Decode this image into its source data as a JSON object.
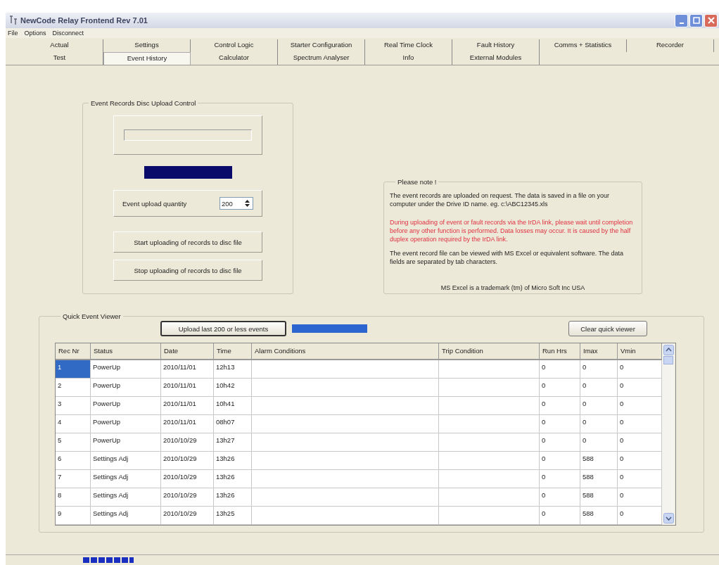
{
  "window": {
    "title": "NewCode Relay Frontend  Rev 7.01"
  },
  "menu": [
    "File",
    "Options",
    "Disconnect"
  ],
  "tabs": [
    [
      {
        "label": "Actual",
        "selected": false
      },
      {
        "label": "Settings",
        "selected": false
      },
      {
        "label": "Control Logic",
        "selected": false
      },
      {
        "label": "Starter Configuration",
        "selected": false
      },
      {
        "label": "Real Time Clock",
        "selected": false
      },
      {
        "label": "Fault History",
        "selected": false
      },
      {
        "label": "Comms + Statistics",
        "selected": false
      },
      {
        "label": "Recorder",
        "selected": false
      }
    ],
    [
      {
        "label": "Test",
        "selected": false
      },
      {
        "label": "Event History",
        "selected": true
      },
      {
        "label": "Calculator",
        "selected": false
      },
      {
        "label": "Spectrum Analyser",
        "selected": false
      },
      {
        "label": "Info",
        "selected": false
      },
      {
        "label": "External Modules",
        "selected": false
      }
    ]
  ],
  "upload_control": {
    "title": "Event Records Disc Upload Control",
    "progress": {
      "level": 1
    },
    "quantity_label": "Event upload quantity",
    "quantity": "200",
    "buttons": [
      "Start uploading of records to disc file",
      "Stop uploading of records to disc file"
    ]
  },
  "note": {
    "title": "Please note !",
    "paragraphs": [
      {
        "kind": "normal",
        "text": "The event records are uploaded on request.  The data is saved in a file on your computer under the Drive ID name.   eg.  c:\\ABC12345.xls"
      },
      {
        "kind": "warning",
        "text": "During uploading of event or fault records via the IrDA link, please wait until completion before any other function is performed.  Data losses may occur. It is caused by the half duplex operation required by the IrDA link."
      },
      {
        "kind": "normal",
        "text": "The event record file can be viewed with MS Excel or equivalent software. The data fields are separated by tab characters."
      }
    ],
    "footer": "MS Excel is a trademark (tm) of Micro Soft Inc USA"
  },
  "viewer": {
    "title": "Quick Event Viewer",
    "upload_button": "Upload last 200 or less events",
    "clear_button": "Clear quick viewer",
    "columns": [
      "Rec Nr",
      "Status",
      "Date",
      "Time",
      "Alarm Conditions",
      "Trip Condition",
      "Run Hrs",
      "Imax",
      "Vmin"
    ],
    "rows": [
      {
        "rec": "1",
        "status": "PowerUp",
        "date": "2010/11/01",
        "time": "12h13",
        "run_hrs": "0",
        "imax": "0",
        "vmin": "0",
        "selected": true
      },
      {
        "rec": "2",
        "status": "PowerUp",
        "date": "2010/11/01",
        "time": "10h42",
        "run_hrs": "0",
        "imax": "0",
        "vmin": "0",
        "selected": false
      },
      {
        "rec": "3",
        "status": "PowerUp",
        "date": "2010/11/01",
        "time": "10h41",
        "run_hrs": "0",
        "imax": "0",
        "vmin": "0",
        "selected": false
      },
      {
        "rec": "4",
        "status": "PowerUp",
        "date": "2010/11/01",
        "time": "08h07",
        "run_hrs": "0",
        "imax": "0",
        "vmin": "0",
        "selected": false
      },
      {
        "rec": "5",
        "status": "PowerUp",
        "date": "2010/10/29",
        "time": "13h27",
        "run_hrs": "0",
        "imax": "0",
        "vmin": "0",
        "selected": false
      },
      {
        "rec": "6",
        "status": "Settings Adj",
        "date": "2010/10/29",
        "time": "13h26",
        "run_hrs": "0",
        "imax": "588",
        "vmin": "0",
        "selected": false
      },
      {
        "rec": "7",
        "status": "Settings Adj",
        "date": "2010/10/29",
        "time": "13h26",
        "run_hrs": "0",
        "imax": "588",
        "vmin": "0",
        "selected": false
      },
      {
        "rec": "8",
        "status": "Settings Adj",
        "date": "2010/10/29",
        "time": "13h26",
        "run_hrs": "0",
        "imax": "588",
        "vmin": "0",
        "selected": false
      },
      {
        "rec": "9",
        "status": "Settings Adj",
        "date": "2010/10/29",
        "time": "13h25",
        "run_hrs": "0",
        "imax": "588",
        "vmin": "0",
        "selected": false
      }
    ]
  }
}
